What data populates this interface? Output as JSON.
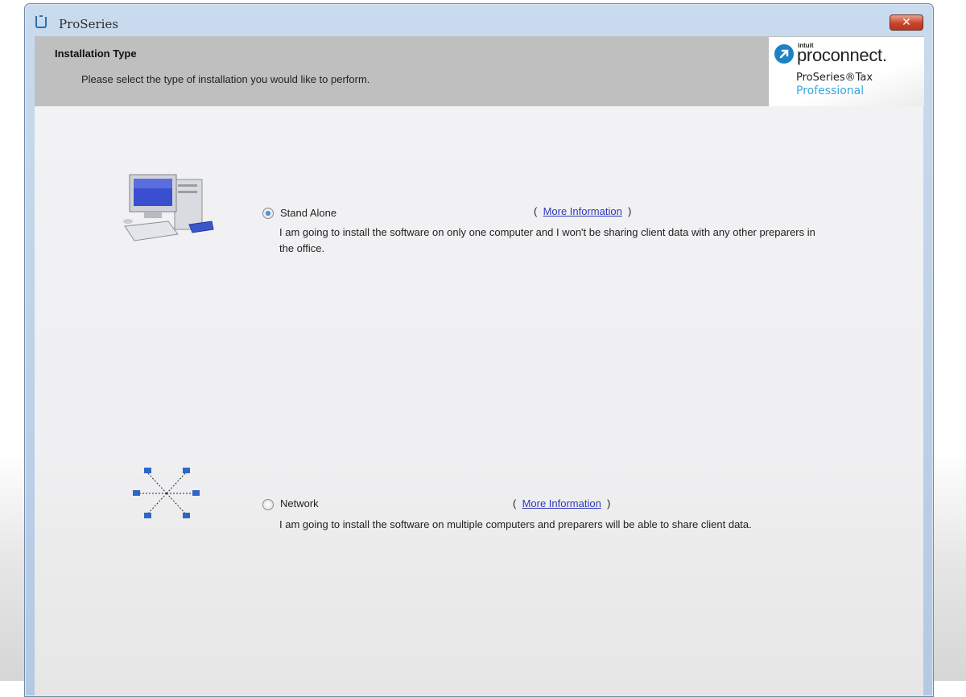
{
  "window": {
    "title": "ProSeries",
    "close_glyph": "✕"
  },
  "header": {
    "title": "Installation Type",
    "subtitle": "Please select the type of installation you would like to perform."
  },
  "logo": {
    "intuit": "intuit",
    "brand": "proconnect.",
    "product": "ProSeries®Tax",
    "edition": "Professional"
  },
  "options": [
    {
      "label": "Stand Alone",
      "selected": true,
      "more_info": "More Information",
      "description": "I am going to install the software on only one computer and I won't be sharing client data with any other preparers in the office.",
      "icon": "desktop-computer-icon"
    },
    {
      "label": "Network",
      "selected": false,
      "more_info": "More Information",
      "description": "I am going to install the software on multiple computers and preparers will be able to share client data.",
      "icon": "network-icon"
    }
  ],
  "colors": {
    "link": "#2f38b8",
    "header_bg": "#bfbfbf",
    "close_red": "#c7442b",
    "brand_blue": "#1b82c4"
  }
}
